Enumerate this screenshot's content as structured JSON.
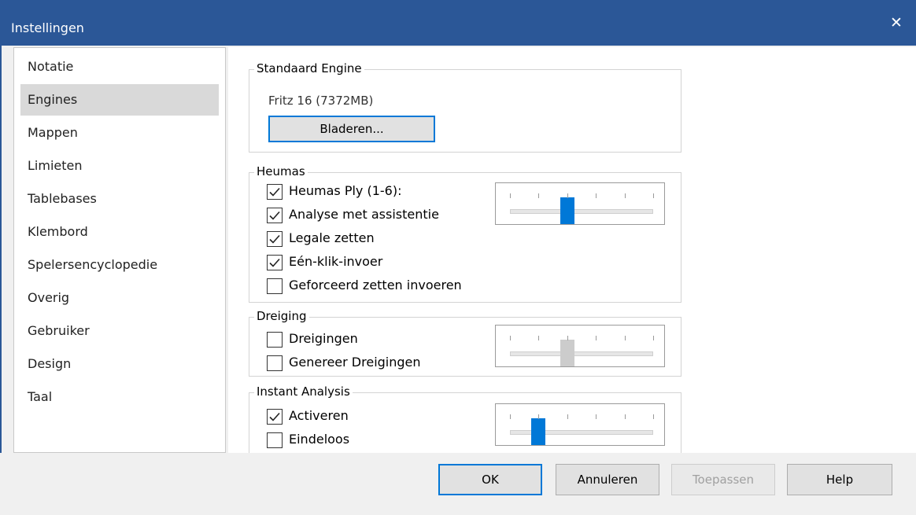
{
  "window": {
    "title": "Instellingen",
    "close_glyph": "✕"
  },
  "sidebar": {
    "items": [
      {
        "label": "Notatie",
        "selected": false
      },
      {
        "label": "Engines",
        "selected": true
      },
      {
        "label": "Mappen",
        "selected": false
      },
      {
        "label": "Limieten",
        "selected": false
      },
      {
        "label": "Tablebases",
        "selected": false
      },
      {
        "label": "Klembord",
        "selected": false
      },
      {
        "label": "Spelersencyclopedie",
        "selected": false
      },
      {
        "label": "Overig",
        "selected": false
      },
      {
        "label": "Gebruiker",
        "selected": false
      },
      {
        "label": "Design",
        "selected": false
      },
      {
        "label": "Taal",
        "selected": false
      }
    ]
  },
  "standard_engine": {
    "group_label": "Standaard Engine",
    "engine_name": "Fritz 16  (7372MB)",
    "browse_label": "Bladeren..."
  },
  "heumas": {
    "group_label": "Heumas",
    "options": [
      {
        "label": "Heumas Ply (1-6):",
        "checked": true
      },
      {
        "label": "Analyse met assistentie",
        "checked": true
      },
      {
        "label": "Legale zetten",
        "checked": true
      },
      {
        "label": "Eén-klik-invoer",
        "checked": true
      },
      {
        "label": "Geforceerd zetten invoeren",
        "checked": false
      }
    ],
    "slider": {
      "min": 1,
      "max": 6,
      "value": 3,
      "enabled": true
    }
  },
  "dreiging": {
    "group_label": "Dreiging",
    "options": [
      {
        "label": "Dreigingen",
        "checked": false
      },
      {
        "label": "Genereer Dreigingen",
        "checked": false
      }
    ],
    "slider": {
      "min": 1,
      "max": 6,
      "value": 3,
      "enabled": false
    }
  },
  "instant_analysis": {
    "group_label": "Instant Analysis",
    "options": [
      {
        "label": "Activeren",
        "checked": true
      },
      {
        "label": "Eindeloos",
        "checked": false
      }
    ],
    "slider": {
      "min": 1,
      "max": 6,
      "value": 2,
      "enabled": true
    }
  },
  "footer": {
    "ok_label": "OK",
    "cancel_label": "Annuleren",
    "apply_label": "Toepassen",
    "help_label": "Help"
  },
  "colors": {
    "title_bar": "#2b5797",
    "accent": "#0078d7",
    "disabled_thumb": "#cccccc"
  }
}
